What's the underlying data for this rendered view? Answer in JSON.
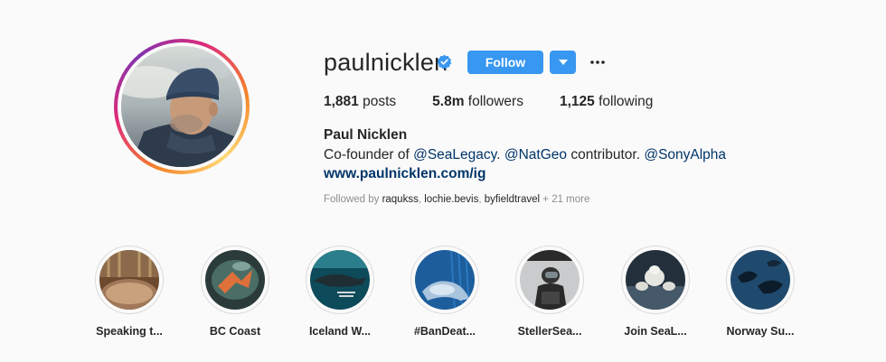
{
  "profile": {
    "username": "paulnicklen",
    "follow_label": "Follow",
    "more_label": "•••",
    "stats": {
      "posts_count": "1,881",
      "posts_label": " posts",
      "followers_count": "5.8m",
      "followers_label": " followers",
      "following_count": "1,125",
      "following_label": " following"
    },
    "full_name": "Paul Nicklen",
    "bio": {
      "prefix": "Co-founder of ",
      "link1": "@SeaLegacy",
      "mid1": ". ",
      "link2": "@NatGeo",
      "mid2": " contributor. ",
      "link3": "@SonyAlpha"
    },
    "website": "www.paulnicklen.com/ig",
    "followed_by": {
      "prefix": "Followed by ",
      "user1": "raqukss",
      "sep1": ", ",
      "user2": "lochie.bevis",
      "sep2": ", ",
      "user3": "byfieldtravel",
      "suffix": " + 21 more"
    }
  },
  "highlights": [
    {
      "label": "Speaking t..."
    },
    {
      "label": "BC Coast"
    },
    {
      "label": "Iceland W..."
    },
    {
      "label": "#BanDeat..."
    },
    {
      "label": "StellerSea..."
    },
    {
      "label": "Join SeaL..."
    },
    {
      "label": "Norway Su..."
    }
  ],
  "colors": {
    "accent": "#3897f0",
    "link": "#003569",
    "muted": "#8e8e8e",
    "text": "#262626",
    "background": "#fafafa"
  },
  "icons": {
    "verified": "verified-badge-icon",
    "dropdown": "caret-down-icon",
    "more": "more-options-icon"
  }
}
